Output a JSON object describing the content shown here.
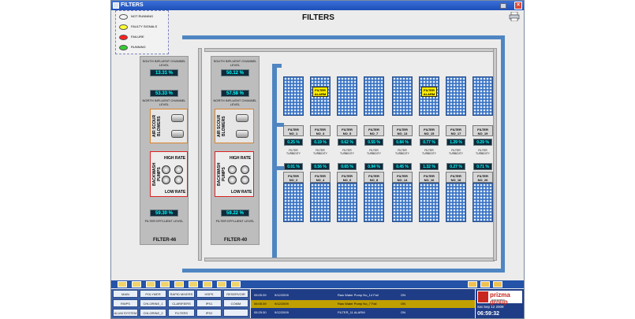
{
  "window": {
    "title": "FILTERS",
    "close_glyph": "×"
  },
  "page_title": "FILTERS",
  "legend": [
    {
      "label": "NOT RUNNING",
      "color": "#f4f4f4"
    },
    {
      "label": "FAULTY SIGNALS",
      "color": "#ffff33"
    },
    {
      "label": "FAILURE",
      "color": "#ff2020"
    },
    {
      "label": "RUNNING",
      "color": "#33cc33"
    }
  ],
  "panels": [
    {
      "south_label": "SOUTH INFLUENT CHANNEL LEVEL",
      "south_value": "13.31 %",
      "north_value": "53.33 %",
      "north_label": "NORTH INFLUENT CHANNEL LEVEL",
      "blower_label": "AIR SCOUR BLOWERS",
      "pump_label": "BACKWASH PUMPS",
      "high_rate": "HIGH RATE",
      "low_rate": "LOW RATE",
      "effluent_value": "59.30 %",
      "effluent_label": "FILTER EFFLUENT LEVEL",
      "name": "FILTER-46"
    },
    {
      "south_label": "SOUTH INFLUENT CHANNEL LEVEL",
      "south_value": "50.12 %",
      "north_value": "57.58 %",
      "north_label": "NORTH INFLUENT CHANNEL LEVEL",
      "blower_label": "AIR SCOUR BLOWERS",
      "pump_label": "BACKWASH PUMPS",
      "high_rate": "HIGH RATE",
      "low_rate": "LOW RATE",
      "effluent_value": "59.22 %",
      "effluent_label": "FILTER EFFLUENT LEVEL",
      "name": "FILTER-40"
    }
  ],
  "alarm_text": "FILTER ALARM",
  "turbidity_label": "FILTER TURBIDITY",
  "filters_top": [
    {
      "name": "FILTER NO_1",
      "value": "0.25 %",
      "alarm": false
    },
    {
      "name": "FILTER NO_3",
      "value": "0.19 %",
      "alarm": true
    },
    {
      "name": "FILTER NO_5",
      "value": "0.62 %",
      "alarm": false
    },
    {
      "name": "FILTER NO_7",
      "value": "0.55 %",
      "alarm": false
    },
    {
      "name": "FILTER NO_13",
      "value": "0.84 %",
      "alarm": false
    },
    {
      "name": "FILTER NO_15",
      "value": "0.77 %",
      "alarm": true
    },
    {
      "name": "FILTER NO_17",
      "value": "1.29 %",
      "alarm": false
    },
    {
      "name": "FILTER NO_19",
      "value": "0.29 %",
      "alarm": false
    }
  ],
  "filters_bottom": [
    {
      "name": "FILTER NO_2",
      "value": "0.01 %"
    },
    {
      "name": "FILTER NO_4",
      "value": "0.56 %"
    },
    {
      "name": "FILTER NO_6",
      "value": "0.65 %"
    },
    {
      "name": "FILTER NO_8",
      "value": "0.94 %"
    },
    {
      "name": "FILTER NO_14",
      "value": "0.45 %"
    },
    {
      "name": "FILTER NO_16",
      "value": "1.32 %"
    },
    {
      "name": "FILTER NO_18",
      "value": "0.27 %"
    },
    {
      "name": "FILTER NO_20",
      "value": "0.71 %"
    }
  ],
  "nav": [
    [
      "MAIN",
      "POLYMER",
      "RAPID MIXERS",
      "HSPS",
      "RESERVOIR"
    ],
    [
      "RWPS",
      "CHLORINE_1",
      "CLARIFIERS",
      "IPS1",
      "COMM"
    ],
    [
      "ALUM SYSTEM",
      "CHLORINE_2",
      "FILTERS",
      "IPS2",
      ""
    ]
  ],
  "alarm_log": [
    {
      "time": "05:05:39",
      "date": "9/12/2009",
      "message": "Raw Water Pump No_14 Fail",
      "status": "ON"
    },
    {
      "time": "06:05:39",
      "date": "9/12/2009",
      "message": "Raw Water Pump No_7 Fail",
      "status": "ON"
    },
    {
      "time": "05:25:30",
      "date": "9/12/2009",
      "message": "FILTER_11 ALARM",
      "status": "ON"
    }
  ],
  "brand": {
    "name": "prizma group",
    "tagline": "automation",
    "date": "Sat Sep 12 2009",
    "time": "06:59:32"
  }
}
